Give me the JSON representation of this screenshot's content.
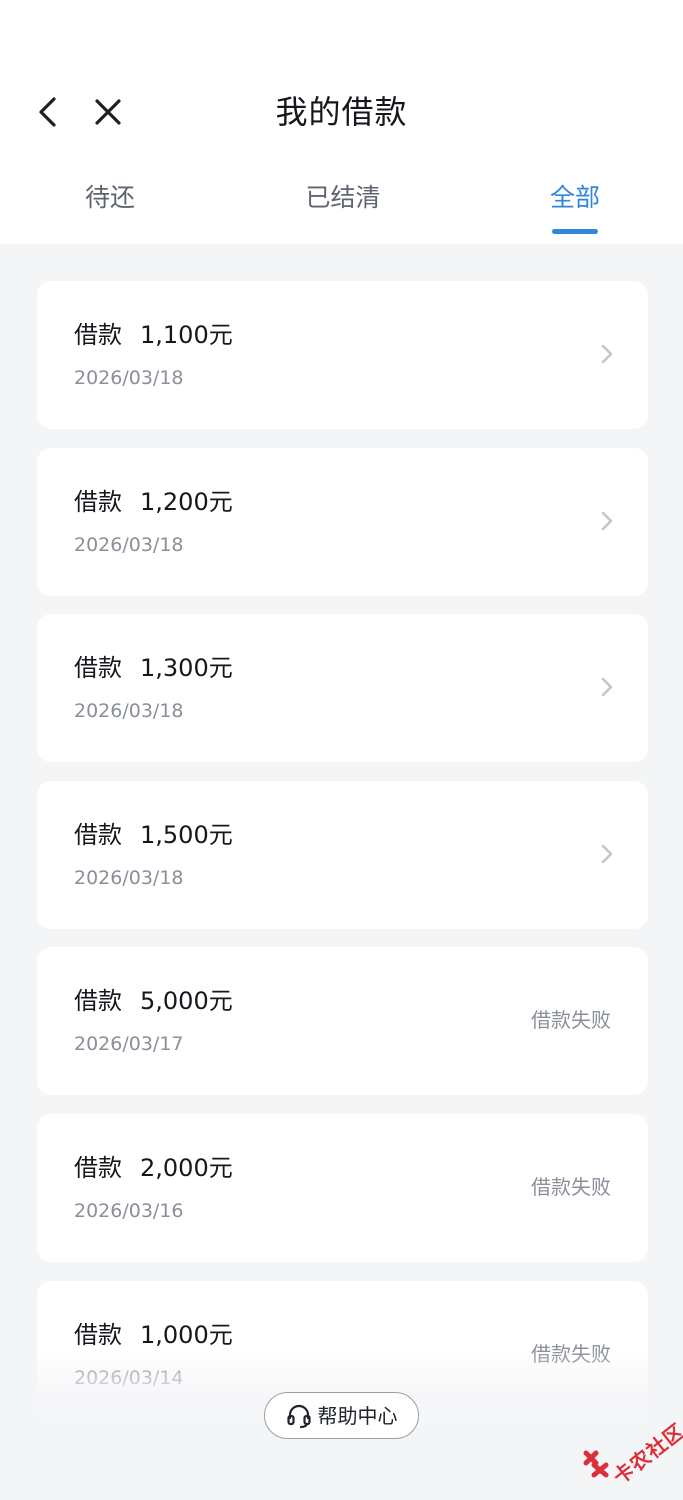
{
  "header": {
    "title": "我的借款",
    "back_icon": "chevron-left-icon",
    "close_icon": "close-icon"
  },
  "tabs": [
    {
      "label": "待还",
      "active": false
    },
    {
      "label": "已结清",
      "active": false
    },
    {
      "label": "全部",
      "active": true
    }
  ],
  "loans": [
    {
      "label": "借款",
      "amount": "1,100元",
      "date": "2026/03/18",
      "status": "",
      "has_chevron": true
    },
    {
      "label": "借款",
      "amount": "1,200元",
      "date": "2026/03/18",
      "status": "",
      "has_chevron": true
    },
    {
      "label": "借款",
      "amount": "1,300元",
      "date": "2026/03/18",
      "status": "",
      "has_chevron": true
    },
    {
      "label": "借款",
      "amount": "1,500元",
      "date": "2026/03/18",
      "status": "",
      "has_chevron": true
    },
    {
      "label": "借款",
      "amount": "5,000元",
      "date": "2026/03/17",
      "status": "借款失败",
      "has_chevron": false
    },
    {
      "label": "借款",
      "amount": "2,000元",
      "date": "2026/03/16",
      "status": "借款失败",
      "has_chevron": false
    },
    {
      "label": "借款",
      "amount": "1,000元",
      "date": "2026/03/14",
      "status": "借款失败",
      "has_chevron": false
    }
  ],
  "help": {
    "label": "帮助中心",
    "icon": "headset-icon"
  },
  "watermark": {
    "text": "卡农社区"
  },
  "colors": {
    "accent": "#2f86db",
    "background": "#f4f5f7",
    "card": "#ffffff",
    "text_primary": "#15171c",
    "text_secondary": "#8a8f9a",
    "watermark": "#d9303a"
  }
}
